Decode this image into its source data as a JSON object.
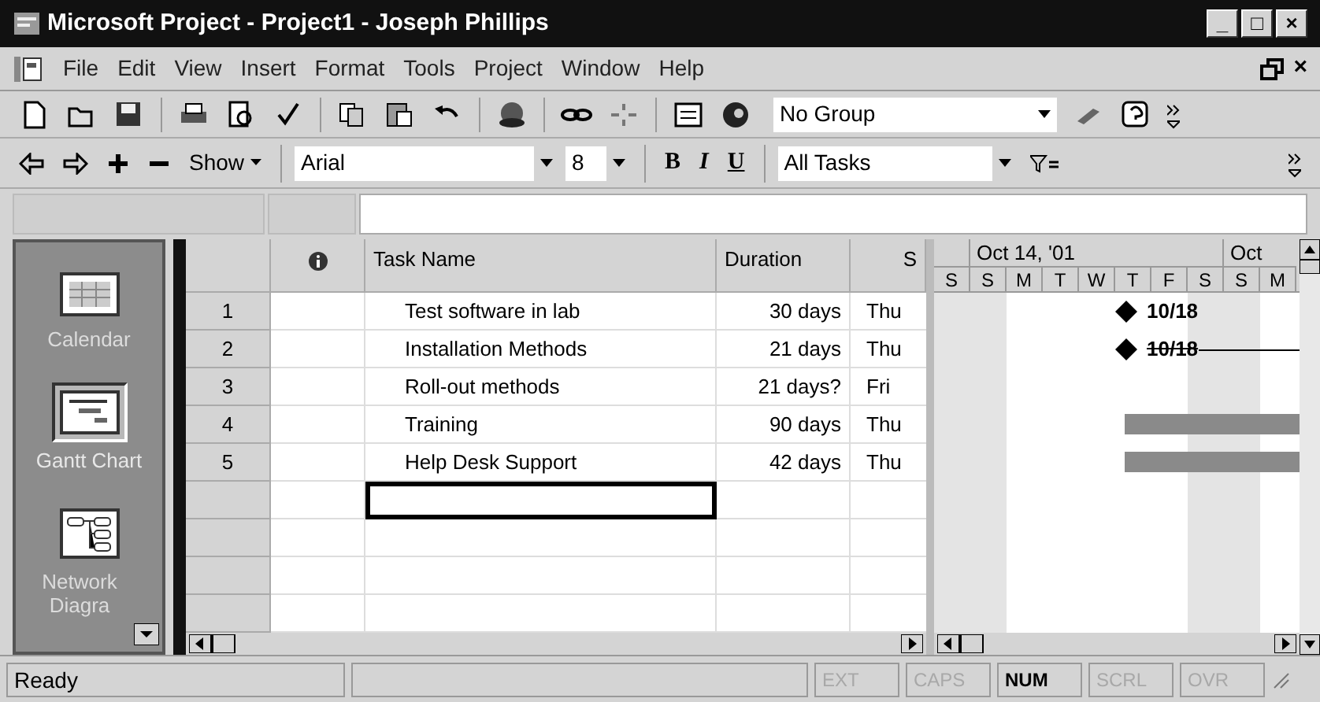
{
  "window": {
    "title": "Microsoft Project - Project1 - Joseph Phillips",
    "controls": [
      "_",
      "□",
      "×"
    ]
  },
  "menu": {
    "items": [
      "File",
      "Edit",
      "View",
      "Insert",
      "Format",
      "Tools",
      "Project",
      "Window",
      "Help"
    ],
    "doc_close": "×"
  },
  "standard_toolbar": {
    "group_dropdown": "No Group"
  },
  "formatting_toolbar": {
    "show_button": "Show",
    "font": "Arial",
    "size": "8",
    "bold": "B",
    "italic": "I",
    "underline": "U",
    "filter": "All Tasks"
  },
  "view_bar": [
    {
      "label": "Calendar",
      "selected": false,
      "kind": "calendar"
    },
    {
      "label": "Gantt Chart",
      "selected": true,
      "kind": "gantt"
    },
    {
      "label": "Network Diagra",
      "selected": false,
      "kind": "network"
    }
  ],
  "table": {
    "columns": [
      "Task Name",
      "Duration",
      "S"
    ],
    "rows": [
      {
        "id": "1",
        "name": "Test software in lab",
        "duration": "30 days",
        "start": "Thu"
      },
      {
        "id": "2",
        "name": "Installation Methods",
        "duration": "21 days",
        "start": "Thu"
      },
      {
        "id": "3",
        "name": "Roll-out methods",
        "duration": "21 days?",
        "start": "Fri"
      },
      {
        "id": "4",
        "name": "Training",
        "duration": "90 days",
        "start": "Thu"
      },
      {
        "id": "5",
        "name": "Help Desk Support",
        "duration": "42 days",
        "start": "Thu"
      }
    ],
    "blank_rows": [
      {
        "selected": true
      },
      {
        "selected": false
      },
      {
        "selected": false
      },
      {
        "selected": false
      }
    ]
  },
  "gantt": {
    "weeks": [
      "Oct 14, '01",
      "Oct"
    ],
    "days": [
      {
        "label": "S",
        "weekend": true
      },
      {
        "label": "S",
        "weekend": true
      },
      {
        "label": "M",
        "weekend": false
      },
      {
        "label": "T",
        "weekend": false
      },
      {
        "label": "W",
        "weekend": false
      },
      {
        "label": "T",
        "weekend": false
      },
      {
        "label": "F",
        "weekend": false
      },
      {
        "label": "S",
        "weekend": true
      },
      {
        "label": "S",
        "weekend": true
      },
      {
        "label": "M",
        "weekend": false
      }
    ],
    "bars": [
      {
        "kind": "milestone",
        "label": "10/18"
      },
      {
        "kind": "milestone-line",
        "label": "10/18"
      },
      {
        "kind": "none"
      },
      {
        "kind": "bar"
      },
      {
        "kind": "bar"
      }
    ]
  },
  "status_bar": {
    "text": "Ready",
    "indicators": [
      {
        "label": "EXT",
        "on": false
      },
      {
        "label": "CAPS",
        "on": false
      },
      {
        "label": "NUM",
        "on": true
      },
      {
        "label": "SCRL",
        "on": false
      },
      {
        "label": "OVR",
        "on": false
      }
    ]
  }
}
